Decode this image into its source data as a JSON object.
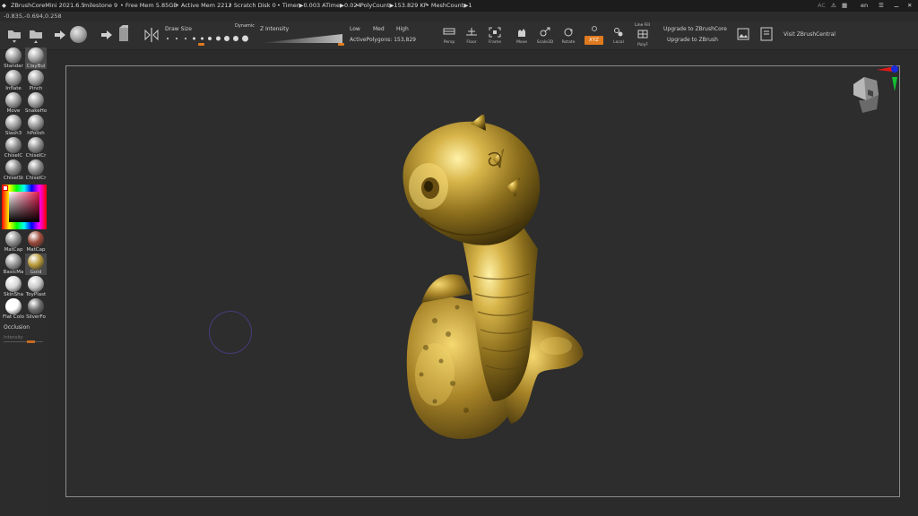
{
  "titlebar": {
    "app": "ZBrushCoreMini 2021.6.5",
    "project": "milestone 9",
    "free_mem": "• Free Mem 5.85GB",
    "active_mem": "• Active Mem 2212",
    "scratch": "• Scratch Disk 0",
    "timer": "• Timer▶0.003 ATime▶0.024",
    "polycount": "• PolyCount▶153.829 KP",
    "meshcount": "• MeshCount▶1",
    "ac": "AC",
    "lang": "en"
  },
  "coords": "-0.835,-0.694,0.258",
  "toolbar": {
    "draw_size_label": "Draw Size",
    "dynamic_label": "Dynamic",
    "z_intensity_label": "Z Intensity",
    "low": "Low",
    "med": "Med",
    "high": "High",
    "active_polygons": "ActivePolygons: 153,829",
    "buttons": [
      {
        "label": "Persp",
        "icon": "perspective-icon"
      },
      {
        "label": "Floor",
        "icon": "floor-icon"
      },
      {
        "label": "Frame",
        "icon": "frame-icon"
      },
      {
        "label": "Move",
        "icon": "move-icon"
      },
      {
        "label": "Scale3D",
        "icon": "scale-icon"
      },
      {
        "label": "Rotate",
        "icon": "rotate-icon"
      },
      {
        "label": "XYZ",
        "icon": "xyz-icon"
      },
      {
        "label": "Local",
        "icon": "local-icon"
      },
      {
        "label": "PolyF",
        "icon": "polyframe-icon"
      }
    ],
    "line_fill_label": "Line Fill",
    "upgrade_core": "Upgrade to ZBrushCore",
    "upgrade_zbrush": "Upgrade to ZBrush",
    "visit": "Visit ZBrushCentral"
  },
  "shelf": {
    "brushes": [
      {
        "label": "Standar",
        "color": "#9c9c9c"
      },
      {
        "label": "ClayBui",
        "color": "#a8a8a8",
        "selected": true
      },
      {
        "label": "Inflate",
        "color": "#9e9e9e"
      },
      {
        "label": "Pinch",
        "color": "#a2a2a2"
      },
      {
        "label": "Move",
        "color": "#9c9c9c"
      },
      {
        "label": "SnakeHo",
        "color": "#a0a0a0"
      },
      {
        "label": "Slash3",
        "color": "#a3a3a3"
      },
      {
        "label": "hPolish",
        "color": "#9a9a9a"
      },
      {
        "label": "ChiselC",
        "color": "#8e8e8e"
      },
      {
        "label": "ChiselCr",
        "color": "#8e8e8e"
      },
      {
        "label": "ChiselSt",
        "color": "#8a8a8a"
      },
      {
        "label": "ChiselCr",
        "color": "#8a8a8a"
      }
    ],
    "materials": [
      {
        "label": "MatCap",
        "color": "#8f8f8f"
      },
      {
        "label": "MatCap",
        "color": "#9b4a3a"
      },
      {
        "label": "BasicMa",
        "color": "#9a9a9a"
      },
      {
        "label": "Gold",
        "color": "#b89a3a",
        "selected": true
      },
      {
        "label": "SkinSha",
        "color": "#d8d8d8"
      },
      {
        "label": "ToyPlast",
        "color": "#c8c8c8"
      },
      {
        "label": "Flat Colo",
        "color": "#ffffff"
      },
      {
        "label": "SilverFo",
        "color": "#6e6e6e"
      }
    ],
    "occlusion_label": "Occlusion",
    "intensity_label": "Intensity"
  }
}
